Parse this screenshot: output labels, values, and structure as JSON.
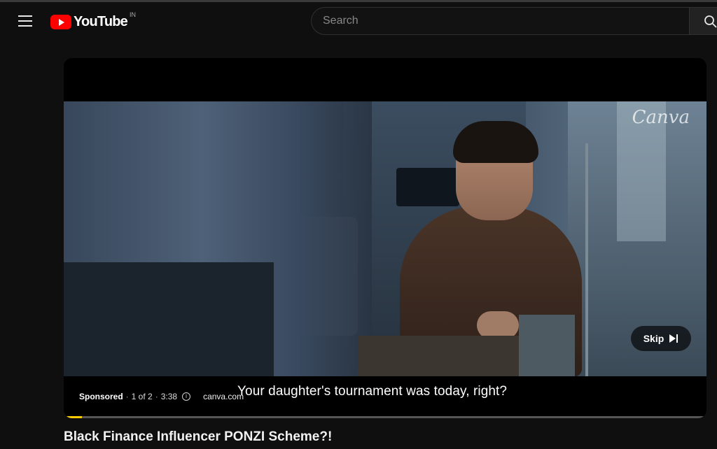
{
  "header": {
    "logo_text": "YouTube",
    "country_code": "IN",
    "search_placeholder": "Search"
  },
  "player": {
    "watermark": "Canva",
    "skip_label": "Skip",
    "ad": {
      "sponsored_label": "Sponsored",
      "position": "1 of 2",
      "separator": "·",
      "duration": "3:38",
      "domain": "canva.com"
    },
    "caption": "Your daughter's tournament was today, right?",
    "ad_progress": 0.028,
    "progress_color": "#ffcc00"
  },
  "video": {
    "title": "Black Finance Influencer PONZI Scheme?!"
  },
  "colors": {
    "background": "#0f0f0f",
    "brand_red": "#ff0000"
  }
}
